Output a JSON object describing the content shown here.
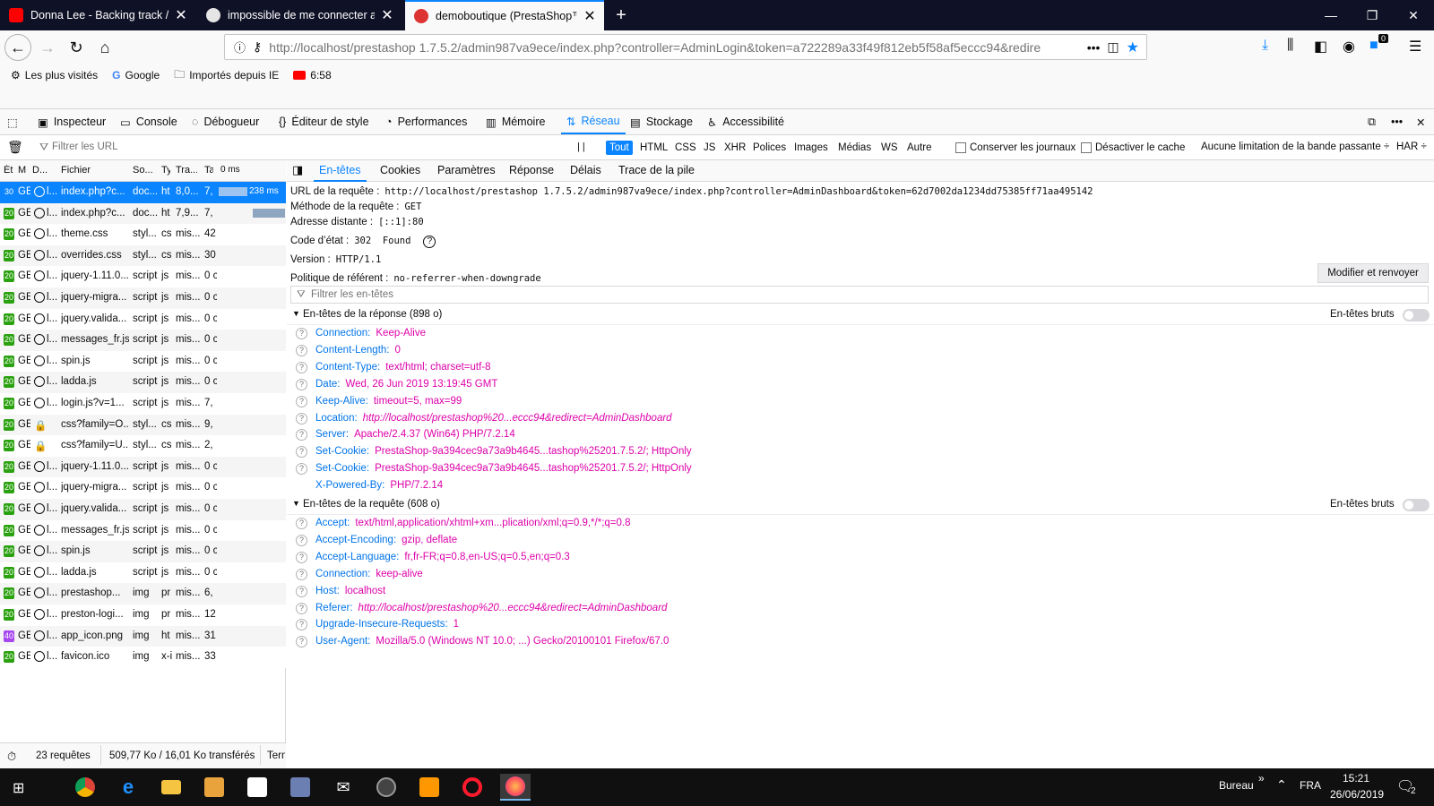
{
  "browser": {
    "tabs": [
      {
        "title": "Donna Lee - Backing track / Pla",
        "active": false
      },
      {
        "title": "impossible de me connecter ad",
        "active": false
      },
      {
        "title": "demoboutique (PrestaShop™)",
        "active": true
      }
    ],
    "url": "http://localhost/prestashop 1.7.5.2/admin987va9ece/index.php?controller=AdminLogin&token=a722289a33f49f812eb5f58af5eccc94&redire",
    "notification_badge": "0",
    "bookmarks": [
      {
        "label": "Les plus visités",
        "icon": "gear-icon"
      },
      {
        "label": "Google",
        "icon": "google-icon"
      },
      {
        "label": "Importés depuis IE",
        "icon": "folder-icon"
      },
      {
        "label": "6:58",
        "icon": "youtube-icon"
      }
    ]
  },
  "devtools": {
    "tabs": [
      "Inspecteur",
      "Console",
      "Débogueur",
      "Éditeur de style",
      "Performances",
      "Mémoire",
      "Réseau",
      "Stockage",
      "Accessibilité"
    ],
    "active_tab": "Réseau",
    "filter_placeholder": "Filtrer les URL",
    "pause_label": "| |",
    "type_filters": [
      "Tout",
      "HTML",
      "CSS",
      "JS",
      "XHR",
      "Polices",
      "Images",
      "Médias",
      "WS",
      "Autre"
    ],
    "persist_label": "Conserver les journaux",
    "cache_label": "Désactiver le cache",
    "throttle_label": "Aucune limitation de la bande passante ÷",
    "har_label": "HAR ÷"
  },
  "request_list": {
    "columns": [
      "Ét",
      "M",
      "D...",
      "Fichier",
      "So...",
      "Ty",
      "Tra...",
      "Ta",
      "0 ms"
    ],
    "rows": [
      {
        "status": "30",
        "method": "GE",
        "domain": "l...",
        "file": "index.php?c...",
        "cause": "doc...",
        "type": "ht",
        "transferred": "8,0...",
        "size": "7,",
        "timing": "238 ms",
        "selected": true,
        "lock": false
      },
      {
        "status": "20",
        "method": "GE",
        "domain": "l...",
        "file": "index.php?c...",
        "cause": "doc...",
        "type": "ht",
        "transferred": "7,9...",
        "size": "7,",
        "timing": "",
        "selected": false,
        "lock": false
      },
      {
        "status": "20",
        "method": "GE",
        "domain": "l...",
        "file": "theme.css",
        "cause": "styl...",
        "type": "cs",
        "transferred": "mis...",
        "size": "42",
        "timing": "",
        "selected": false,
        "lock": false
      },
      {
        "status": "20",
        "method": "GE",
        "domain": "l...",
        "file": "overrides.css",
        "cause": "styl...",
        "type": "cs",
        "transferred": "mis...",
        "size": "30",
        "timing": "",
        "selected": false,
        "lock": false
      },
      {
        "status": "20",
        "method": "GE",
        "domain": "l...",
        "file": "jquery-1.11.0...",
        "cause": "script",
        "type": "js",
        "transferred": "mis...",
        "size": "0 c",
        "timing": "",
        "selected": false,
        "lock": false
      },
      {
        "status": "20",
        "method": "GE",
        "domain": "l...",
        "file": "jquery-migra...",
        "cause": "script",
        "type": "js",
        "transferred": "mis...",
        "size": "0 c",
        "timing": "",
        "selected": false,
        "lock": false
      },
      {
        "status": "20",
        "method": "GE",
        "domain": "l...",
        "file": "jquery.valida...",
        "cause": "script",
        "type": "js",
        "transferred": "mis...",
        "size": "0 c",
        "timing": "",
        "selected": false,
        "lock": false
      },
      {
        "status": "20",
        "method": "GE",
        "domain": "l...",
        "file": "messages_fr.js",
        "cause": "script",
        "type": "js",
        "transferred": "mis...",
        "size": "0 c",
        "timing": "",
        "selected": false,
        "lock": false
      },
      {
        "status": "20",
        "method": "GE",
        "domain": "l...",
        "file": "spin.js",
        "cause": "script",
        "type": "js",
        "transferred": "mis...",
        "size": "0 c",
        "timing": "",
        "selected": false,
        "lock": false
      },
      {
        "status": "20",
        "method": "GE",
        "domain": "l...",
        "file": "ladda.js",
        "cause": "script",
        "type": "js",
        "transferred": "mis...",
        "size": "0 c",
        "timing": "",
        "selected": false,
        "lock": false
      },
      {
        "status": "20",
        "method": "GE",
        "domain": "l...",
        "file": "login.js?v=1...",
        "cause": "script",
        "type": "js",
        "transferred": "mis...",
        "size": "7,",
        "timing": "",
        "selected": false,
        "lock": false
      },
      {
        "status": "20",
        "method": "GE",
        "domain": "",
        "file": "css?family=O...",
        "cause": "styl...",
        "type": "cs",
        "transferred": "mis...",
        "size": "9,",
        "timing": "",
        "selected": false,
        "lock": true
      },
      {
        "status": "20",
        "method": "GE",
        "domain": "",
        "file": "css?family=U...",
        "cause": "styl...",
        "type": "cs",
        "transferred": "mis...",
        "size": "2,",
        "timing": "",
        "selected": false,
        "lock": true
      },
      {
        "status": "20",
        "method": "GE",
        "domain": "l...",
        "file": "jquery-1.11.0...",
        "cause": "script",
        "type": "js",
        "transferred": "mis...",
        "size": "0 c",
        "timing": "",
        "selected": false,
        "lock": false
      },
      {
        "status": "20",
        "method": "GE",
        "domain": "l...",
        "file": "jquery-migra...",
        "cause": "script",
        "type": "js",
        "transferred": "mis...",
        "size": "0 c",
        "timing": "",
        "selected": false,
        "lock": false
      },
      {
        "status": "20",
        "method": "GE",
        "domain": "l...",
        "file": "jquery.valida...",
        "cause": "script",
        "type": "js",
        "transferred": "mis...",
        "size": "0 c",
        "timing": "",
        "selected": false,
        "lock": false
      },
      {
        "status": "20",
        "method": "GE",
        "domain": "l...",
        "file": "messages_fr.js",
        "cause": "script",
        "type": "js",
        "transferred": "mis...",
        "size": "0 c",
        "timing": "",
        "selected": false,
        "lock": false
      },
      {
        "status": "20",
        "method": "GE",
        "domain": "l...",
        "file": "spin.js",
        "cause": "script",
        "type": "js",
        "transferred": "mis...",
        "size": "0 c",
        "timing": "",
        "selected": false,
        "lock": false
      },
      {
        "status": "20",
        "method": "GE",
        "domain": "l...",
        "file": "ladda.js",
        "cause": "script",
        "type": "js",
        "transferred": "mis...",
        "size": "0 c",
        "timing": "",
        "selected": false,
        "lock": false
      },
      {
        "status": "20",
        "method": "GE",
        "domain": "l...",
        "file": "prestashop...",
        "cause": "img",
        "type": "pr",
        "transferred": "mis...",
        "size": "6,",
        "timing": "",
        "selected": false,
        "lock": false
      },
      {
        "status": "20",
        "method": "GE",
        "domain": "l...",
        "file": "preston-logi...",
        "cause": "img",
        "type": "pr",
        "transferred": "mis...",
        "size": "12",
        "timing": "",
        "selected": false,
        "lock": false
      },
      {
        "status": "40",
        "method": "GE",
        "domain": "l...",
        "file": "app_icon.png",
        "cause": "img",
        "type": "ht",
        "transferred": "mis...",
        "size": "31",
        "timing": "",
        "selected": false,
        "lock": false
      },
      {
        "status": "20",
        "method": "GE",
        "domain": "l...",
        "file": "favicon.ico",
        "cause": "img",
        "type": "x-i",
        "transferred": "mis...",
        "size": "33",
        "timing": "",
        "selected": false,
        "lock": false
      }
    ]
  },
  "statusbar": {
    "requests": "23 requêtes",
    "transfer": "509,77 Ko / 16,01 Ko transférés",
    "finish": "Term"
  },
  "details": {
    "tabs": [
      "En-têtes",
      "Cookies",
      "Paramètres",
      "Réponse",
      "Délais",
      "Trace de la pile"
    ],
    "active_tab": "En-têtes",
    "summary": [
      {
        "label": "URL de la requête :",
        "value": "http://localhost/prestashop 1.7.5.2/admin987va9ece/index.php?controller=AdminDashboard&token=62d7002da1234dd75385ff71aa495142"
      },
      {
        "label": "Méthode de la requête :",
        "value": "GET"
      },
      {
        "label": "Adresse distante :",
        "value": "[::1]:80"
      },
      {
        "label": "Code d’état :",
        "value": "302  Found"
      },
      {
        "label": "Version :",
        "value": "HTTP/1.1"
      },
      {
        "label": "Politique de référent :",
        "value": "no-referrer-when-downgrade"
      }
    ],
    "resend_label": "Modifier et renvoyer",
    "filter_placeholder": "Filtrer les en-têtes",
    "raw_label": "En-têtes bruts",
    "response_title": "En-têtes de la réponse (898 o)",
    "response_headers": [
      {
        "name": "Connection:",
        "value": "Keep-Alive",
        "url": false
      },
      {
        "name": "Content-Length:",
        "value": "0",
        "url": false
      },
      {
        "name": "Content-Type:",
        "value": "text/html; charset=utf-8",
        "url": false
      },
      {
        "name": "Date:",
        "value": "Wed, 26 Jun 2019 13:19:45 GMT",
        "url": false
      },
      {
        "name": "Keep-Alive:",
        "value": "timeout=5, max=99",
        "url": false
      },
      {
        "name": "Location:",
        "value": "http://localhost/prestashop%20...eccc94&redirect=AdminDashboard",
        "url": true
      },
      {
        "name": "Server:",
        "value": "Apache/2.4.37 (Win64) PHP/7.2.14",
        "url": false
      },
      {
        "name": "Set-Cookie:",
        "value": "PrestaShop-9a394cec9a73a9b4645...tashop%25201.7.5.2/; HttpOnly",
        "url": false
      },
      {
        "name": "Set-Cookie:",
        "value": "PrestaShop-9a394cec9a73a9b4645...tashop%25201.7.5.2/; HttpOnly",
        "url": false
      },
      {
        "name": "X-Powered-By:",
        "value": "PHP/7.2.14",
        "url": false,
        "noicon": true
      }
    ],
    "request_title": "En-têtes de la requête (608 o)",
    "request_headers": [
      {
        "name": "Accept:",
        "value": "text/html,application/xhtml+xm...plication/xml;q=0.9,*/*;q=0.8",
        "url": false
      },
      {
        "name": "Accept-Encoding:",
        "value": "gzip, deflate",
        "url": false
      },
      {
        "name": "Accept-Language:",
        "value": "fr,fr-FR;q=0.8,en-US;q=0.5,en;q=0.3",
        "url": false
      },
      {
        "name": "Connection:",
        "value": "keep-alive",
        "url": false
      },
      {
        "name": "Host:",
        "value": "localhost",
        "url": false
      },
      {
        "name": "Referer:",
        "value": "http://localhost/prestashop%20...eccc94&redirect=AdminDashboard",
        "url": true
      },
      {
        "name": "Upgrade-Insecure-Requests:",
        "value": "1",
        "url": false
      },
      {
        "name": "User-Agent:",
        "value": "Mozilla/5.0 (Windows NT 10.0; ...) Gecko/20100101 Firefox/67.0",
        "url": false
      }
    ]
  },
  "taskbar": {
    "apps": [
      "chrome",
      "edge",
      "file-explorer",
      "media-player",
      "store",
      "app",
      "mail",
      "app2",
      "sublime",
      "opera",
      "firefox"
    ],
    "desktop_label": "Bureau",
    "chevron": "»",
    "lang": "FRA",
    "time": "15:21",
    "date": "26/06/2019",
    "notif_count": "2"
  },
  "colors": {
    "accent": "#0a84ff",
    "status_ok": "#2aa10f",
    "status_redirect": "#0a84ff",
    "status_error": "#a647f0",
    "header_name": "#0074e8",
    "header_value": "#dd00a9"
  }
}
